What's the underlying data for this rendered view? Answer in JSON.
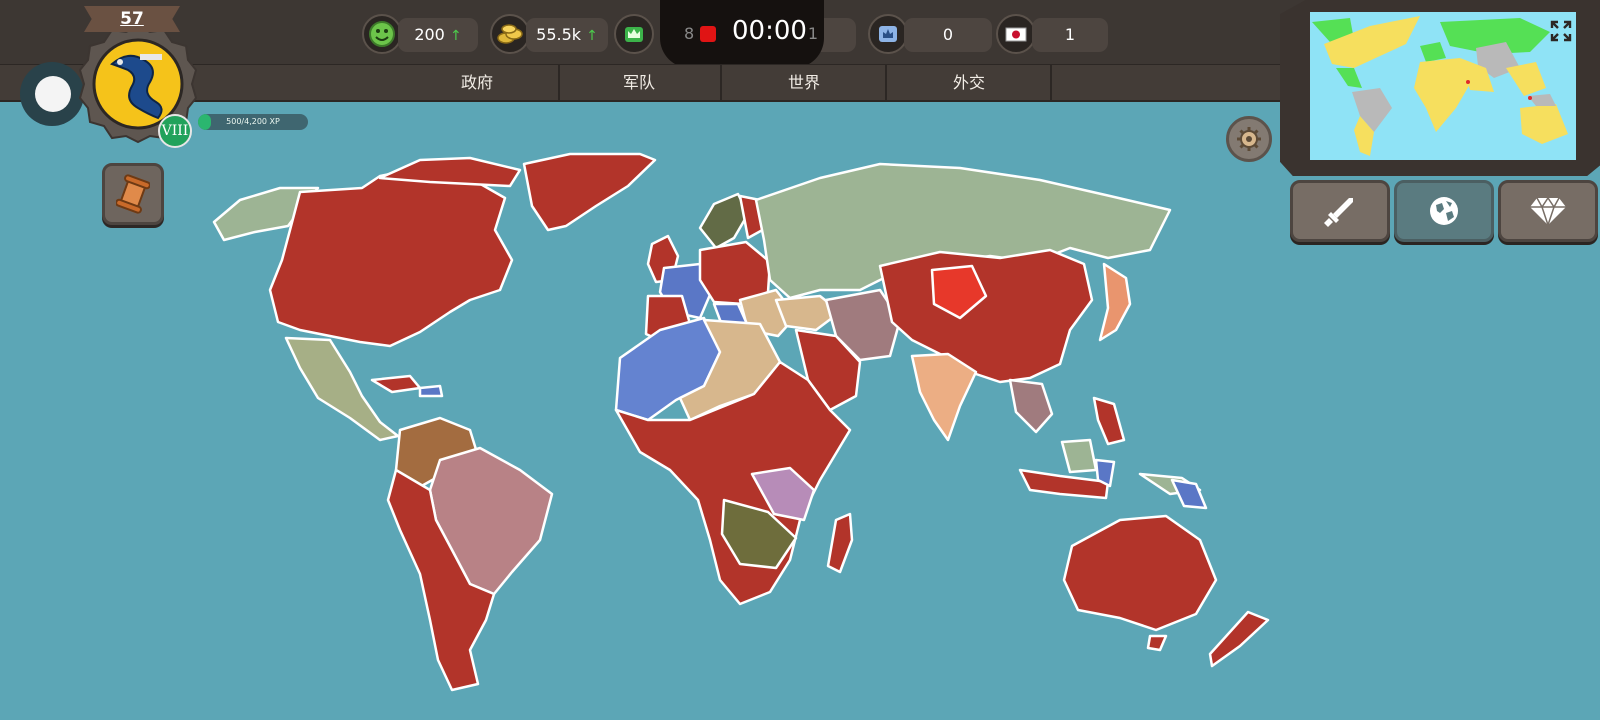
{
  "profile": {
    "level": "57",
    "rank": "VIII",
    "xp_text": "500/4,200 XP",
    "xp_fraction": 0.12
  },
  "resources": {
    "happiness": "200",
    "gold": "55.5k",
    "timer_left": "8",
    "timer": "00:00",
    "timer_right": "1",
    "king": "0",
    "flag": "1"
  },
  "tabs": {
    "government": "政府",
    "army": "军队",
    "world": "世界",
    "diplomacy": "外交"
  },
  "colors": {
    "ocean": "#5ca6b6",
    "player_red": "#b2342a",
    "russia_green": "#9db494",
    "minimap_ocean": "#8fe3f6",
    "minimap_yellow": "#f6df5e",
    "minimap_green": "#55e055",
    "minimap_gray": "#b9b9b9"
  },
  "icons": {
    "happiness": "smiley-icon",
    "gold": "coins-icon",
    "crown": "crown-icon",
    "king": "king-icon",
    "flag": "japan-flag-icon",
    "war": "sword-icon",
    "world": "globe-icon",
    "premium": "diamond-icon"
  }
}
